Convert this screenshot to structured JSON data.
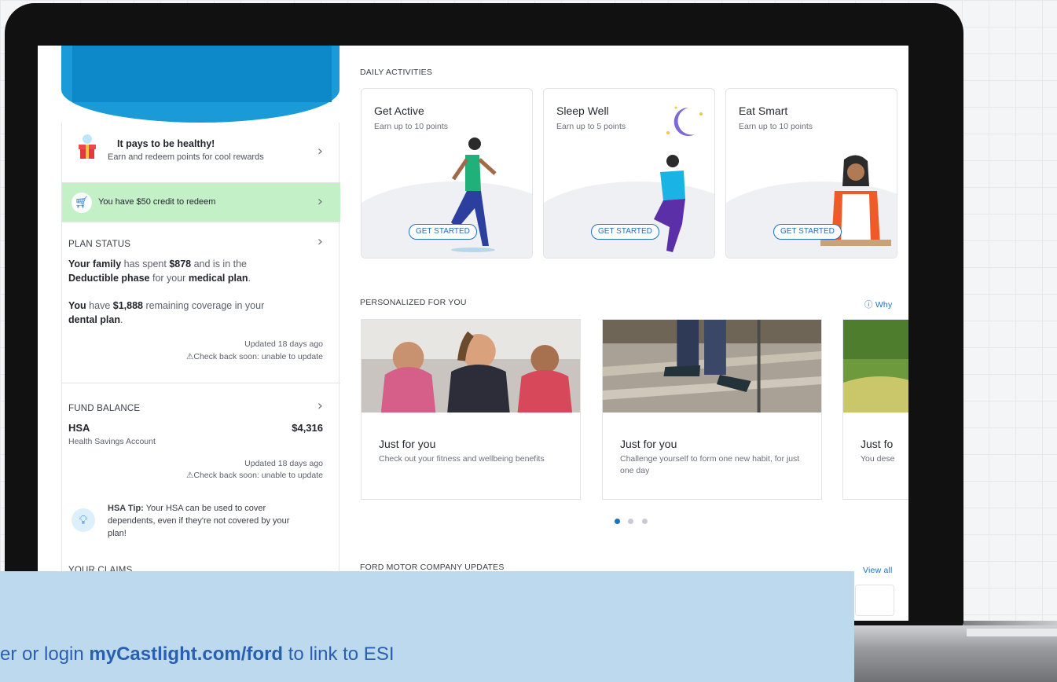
{
  "left": {
    "rewards": {
      "title": "It pays to be healthy!",
      "subtitle": "Earn and redeem points for cool rewards"
    },
    "credit": {
      "text": "You have $50 credit to redeem"
    },
    "plan_status": {
      "title": "PLAN STATUS",
      "line1_a": "Your family",
      "line1_b": " has spent ",
      "line1_c": "$878",
      "line1_d": " and is in the",
      "line2_a": "Deductible phase",
      "line2_b": " for your ",
      "line2_c": "medical plan",
      "line2_d": ".",
      "line3_a": "You",
      "line3_b": " have ",
      "line3_c": "$1,888",
      "line3_d": " remaining coverage in your",
      "line4_a": "dental plan",
      "line4_b": ".",
      "updated": "Updated 18 days ago",
      "warning": "⚠Check back soon: unable to update"
    },
    "fund_balance": {
      "title": "FUND BALANCE",
      "account": "HSA",
      "amount": "$4,316",
      "account_full": "Health Savings Account",
      "updated": "Updated 18 days ago",
      "warning": "⚠Check back soon: unable to update"
    },
    "tip": {
      "label": "HSA Tip:",
      "text1": " Your HSA can be used to cover",
      "text2": "dependents, even if they're not covered by your",
      "text3": "plan!"
    },
    "next_title": "YOUR CLAIMS"
  },
  "daily": {
    "title": "DAILY ACTIVITIES",
    "cards": [
      {
        "title": "Get Active",
        "subtitle": "Earn up to 10 points",
        "button": "GET STARTED"
      },
      {
        "title": "Sleep Well",
        "subtitle": "Earn up to 5 points",
        "button": "GET STARTED"
      },
      {
        "title": "Eat Smart",
        "subtitle": "Earn up to 10 points",
        "button": "GET STARTED"
      }
    ]
  },
  "personalized": {
    "title": "PERSONALIZED FOR YOU",
    "why": "ⓘ Why",
    "cards": [
      {
        "title": "Just for you",
        "subtitle": "Check out your fitness and wellbeing benefits"
      },
      {
        "title": "Just for you",
        "subtitle": "Challenge yourself to form one new habit, for just one day"
      },
      {
        "title": "Just fo",
        "subtitle": "You dese"
      }
    ]
  },
  "updates": {
    "title": "FORD MOTOR COMPANY UPDATES",
    "view_all": "View all"
  },
  "banner": {
    "pre": "er or login ",
    "link": "myCastlight.com/ford",
    "post": " to link to ESI"
  },
  "colors": {
    "hero": "#1a9bd7",
    "credit_bg": "#c4f0c8",
    "accent": "#1f6fc9",
    "banner": "#bcd9ee"
  }
}
